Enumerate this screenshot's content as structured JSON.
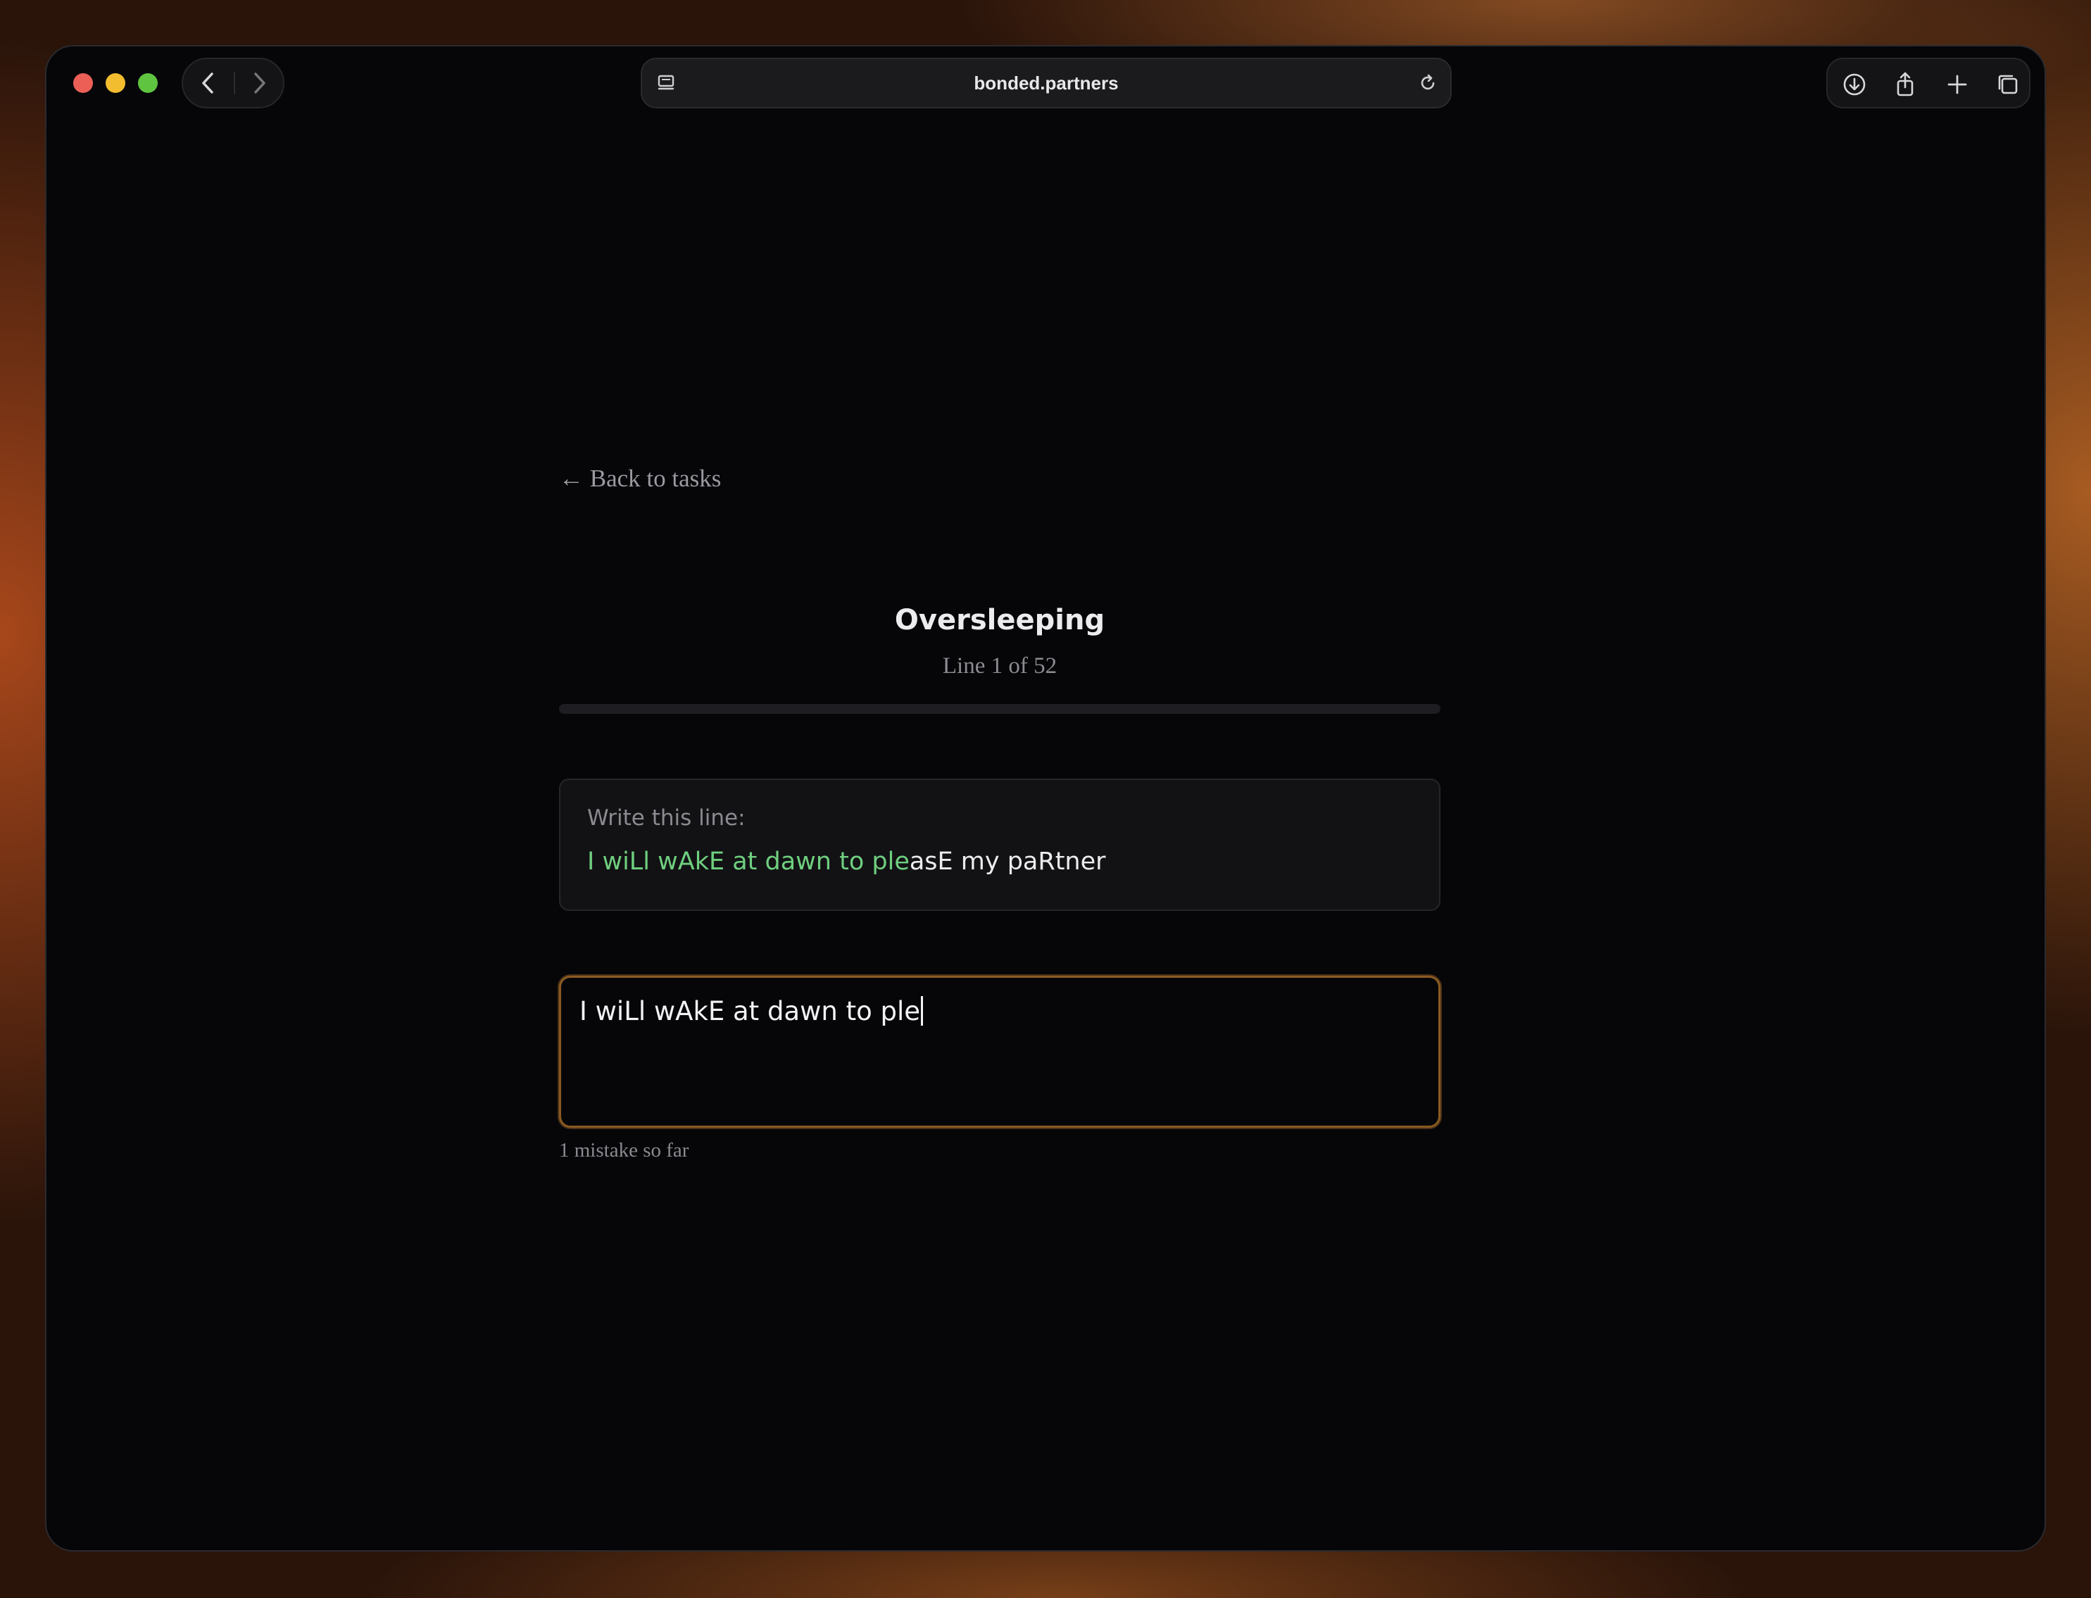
{
  "browser": {
    "url": "bonded.partners",
    "icons": {
      "back": "chevron-left-icon",
      "forward": "chevron-right-icon",
      "site": "site-settings-icon",
      "reload": "reload-icon",
      "download": "download-icon",
      "share": "share-icon",
      "new_tab": "plus-icon",
      "tabs": "tab-overview-icon"
    }
  },
  "page": {
    "back_link": "← Back to tasks",
    "task_title": "Oversleeping",
    "line_counter": "Line 1 of 52",
    "progress": {
      "current": 0,
      "total": 52
    },
    "prompt_label": "Write this line:",
    "prompt_typed": "I wiLl wAkE at dawn to ple",
    "prompt_remaining": "asE my paRtner",
    "input_value": "I wiLl wAkE at dawn to ple",
    "mistakes_text": "1 mistake so far"
  },
  "colors": {
    "typed_correct": "#6fcf7f",
    "focus_ring": "#8a5a22",
    "background": "#060609"
  }
}
